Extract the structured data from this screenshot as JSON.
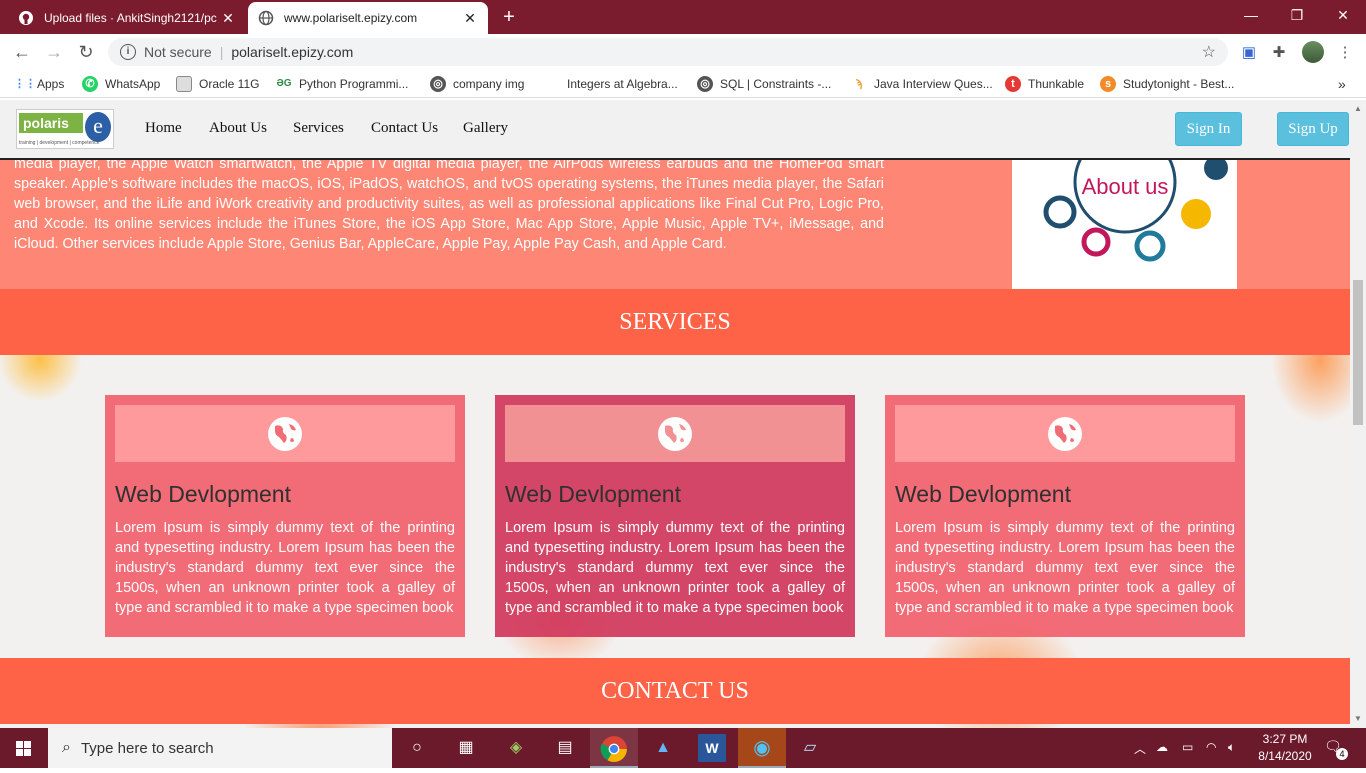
{
  "browser": {
    "tabs": [
      {
        "title": "Upload files · AnkitSingh2121/pc",
        "active": false
      },
      {
        "title": "www.polariselt.epizy.com",
        "active": true
      }
    ],
    "address": {
      "security_text": "Not secure",
      "url": "polariselt.epizy.com"
    },
    "bookmarks": [
      {
        "label": "Apps",
        "icon": "apps-grid-icon"
      },
      {
        "label": "WhatsApp",
        "icon": "whatsapp-icon"
      },
      {
        "label": "Oracle 11G",
        "icon": "page-icon"
      },
      {
        "label": "Python Programmi...",
        "icon": "gfg-icon"
      },
      {
        "label": "company img",
        "icon": "globe-icon"
      },
      {
        "label": "Integers at Algebra...",
        "icon": "blank-icon"
      },
      {
        "label": "SQL | Constraints -...",
        "icon": "globe-icon"
      },
      {
        "label": "Java Interview Ques...",
        "icon": "java-icon"
      },
      {
        "label": "Thunkable",
        "icon": "thunkable-icon"
      },
      {
        "label": "Studytonight - Best...",
        "icon": "studytonight-icon"
      }
    ],
    "bookmarks_overflow": "»"
  },
  "site": {
    "logo": {
      "name": "polaris",
      "tagline": "training | development | competence",
      "letter": "e"
    },
    "nav": [
      "Home",
      "About Us",
      "Services",
      "Contact Us",
      "Gallery"
    ],
    "sign_in": "Sign In",
    "sign_up": "Sign Up",
    "about_text": "media player, the Apple Watch smartwatch, the Apple TV digital media player, the AirPods wireless earbuds and the HomePod smart speaker. Apple's software includes the macOS, iOS, iPadOS, watchOS, and tvOS operating systems, the iTunes media player, the Safari web browser, and the iLife and iWork creativity and productivity suites, as well as professional applications like Final Cut Pro, Logic Pro, and Xcode. Its online services include the iTunes Store, the iOS App Store, Mac App Store, Apple Music, Apple TV+, iMessage, and iCloud. Other services include Apple Store, Genius Bar, AppleCare, Apple Pay, Apple Pay Cash, and Apple Card.",
    "about_image_text": "About us",
    "services_heading": "SERVICES",
    "cards": [
      {
        "title": "Web Devlopment",
        "text": "Lorem Ipsum is simply dummy text of the printing and typesetting industry. Lorem Ipsum has been the industry's standard dummy text ever since the 1500s, when an unknown printer took a galley of type and scrambled it to make a type specimen book",
        "bg": "#f2626e",
        "top_bg": "#ff9396"
      },
      {
        "title": "Web Devlopment",
        "text": "Lorem Ipsum is simply dummy text of the printing and typesetting industry. Lorem Ipsum has been the industry's standard dummy text ever since the 1500s, when an unknown printer took a galley of type and scrambled it to make a type specimen book",
        "bg": "#d23a5e",
        "top_bg": "#f28a8e"
      },
      {
        "title": "Web Devlopment",
        "text": "Lorem Ipsum is simply dummy text of the printing and typesetting industry. Lorem Ipsum has been the industry's standard dummy text ever since the 1500s, when an unknown printer took a galley of type and scrambled it to make a type specimen book",
        "bg": "#f2626e",
        "top_bg": "#ff9396"
      }
    ],
    "contact_heading": "CONTACT US"
  },
  "taskbar": {
    "search_placeholder": "Type here to search",
    "time": "3:27 PM",
    "date": "8/14/2020",
    "notifications": "4"
  },
  "colors": {
    "accent": "#ff6347",
    "chrome": "#7a1b2e",
    "button": "#5bc0de"
  }
}
